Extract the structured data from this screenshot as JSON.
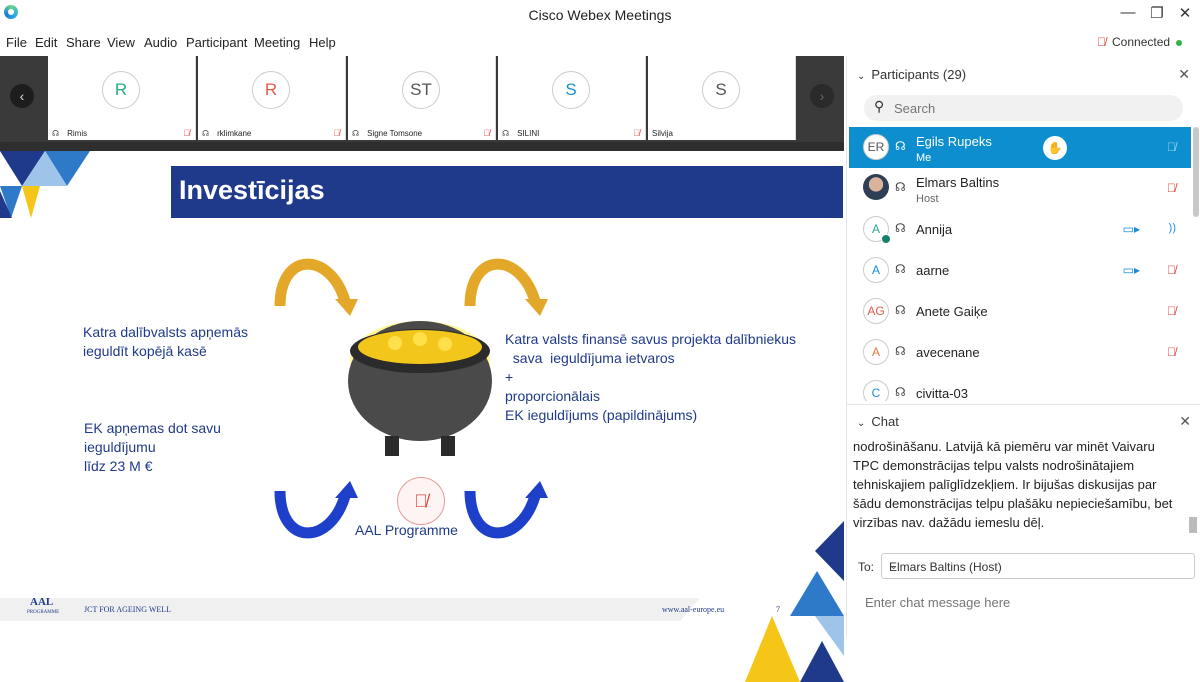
{
  "window": {
    "title": "Cisco Webex Meetings",
    "controls": {
      "minimize": "—",
      "restore": "❐",
      "close": "✕"
    }
  },
  "menu": [
    "File",
    "Edit",
    "Share",
    "View",
    "Audio",
    "Participant",
    "Meeting",
    "Help"
  ],
  "status": {
    "connection": "Connected",
    "color": "#2fb344"
  },
  "thumbnails": [
    {
      "initials": "R",
      "name": "Rimis",
      "color": "#2aa88a",
      "muted": true
    },
    {
      "initials": "R",
      "name": "rklimkane",
      "color": "#e05b4a",
      "muted": true
    },
    {
      "initials": "ST",
      "name": "Signe Tomsone",
      "color": "#555555",
      "muted": true
    },
    {
      "initials": "S",
      "name": "SILINI",
      "color": "#1a8ed6",
      "muted": true
    },
    {
      "initials": "S",
      "name": "Silvija",
      "color": "#555555",
      "muted": false
    }
  ],
  "slide": {
    "title": "Investīcijas",
    "left_top": "Katra dalībvalsts apņemās\nieguldīt kopējā kasē",
    "left_bottom": "EK apņemas dot savu\nieguldījumu\nlīdz 23 M €",
    "right": "Katra valsts finansē savus projekta dalībniekus\n  sava  ieguldījuma ietvaros\n+\nproporcionālais\nEK ieguldījums (papildinājums)",
    "caption": "AAL Programme",
    "footer_logo": "AAL",
    "footer_logo_sub": "PROGRAMME",
    "footer_tagline": "JCT FOR AGEING WELL",
    "footer_url": "www.aal-europe.eu",
    "page_number": "7",
    "brand_blue": "#1f3a8a",
    "brand_yellow": "#f5c518"
  },
  "participants_panel": {
    "title": "Participants (29)",
    "search_placeholder": "Search",
    "list": [
      {
        "initials": "ER",
        "name": "Egils Rupeks",
        "role": "Me",
        "selected": true,
        "photo": false,
        "color": "#555555"
      },
      {
        "initials": "",
        "name": "Elmars Baltins",
        "role": "Host",
        "selected": false,
        "photo": true,
        "color": "#555555"
      },
      {
        "initials": "A",
        "name": "Annija",
        "role": "",
        "selected": false,
        "photo": false,
        "color": "#2aa88a",
        "camera": true,
        "audio_active": true
      },
      {
        "initials": "A",
        "name": "aarne",
        "role": "",
        "selected": false,
        "photo": false,
        "color": "#1a8ed6",
        "camera": true
      },
      {
        "initials": "AG",
        "name": "Anete Gaiķe",
        "role": "",
        "selected": false,
        "photo": false,
        "color": "#e05b4a"
      },
      {
        "initials": "A",
        "name": "avecenane",
        "role": "",
        "selected": false,
        "photo": false,
        "color": "#e07a3a"
      },
      {
        "initials": "C",
        "name": "civitta-03",
        "role": "",
        "selected": false,
        "photo": false,
        "color": "#1a8ed6"
      }
    ]
  },
  "chat_panel": {
    "title": "Chat",
    "message": "nodrošināšanu. Latvijā kā piemēru var minēt Vaivaru\nTPC demonstrācijas telpu valsts nodrošinātajiem\ntehniskajiem palīglīdzekļiem. Ir bijušas diskusijas par\nšādu demonstrācijas telpu plašāku nepieciešamību, bet\nvirzības nav. dažādu iemeslu dēļ.",
    "to_label": "To:",
    "to_value": "Elmars Baltins (Host)",
    "input_placeholder": "Enter chat message here"
  }
}
